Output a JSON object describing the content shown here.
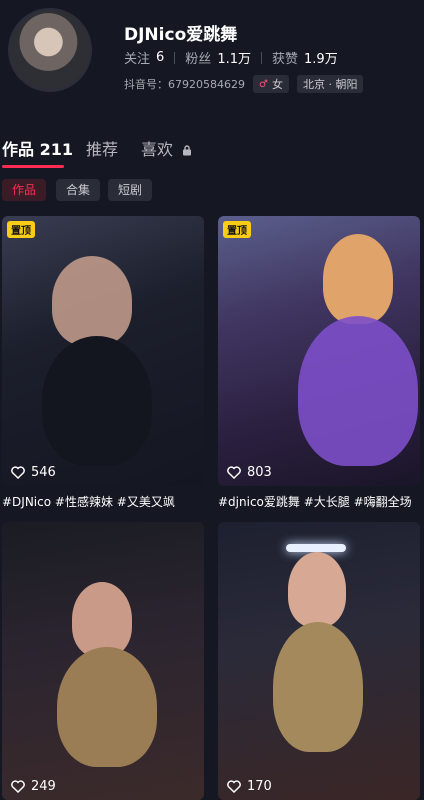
{
  "profile": {
    "nickname": "DJNico爱跳舞",
    "following_label": "关注",
    "following": "6",
    "followers_label": "粉丝",
    "followers": "1.1万",
    "likes_label": "获赞",
    "likes": "1.9万",
    "douyin_id": "抖音号：67920584629",
    "gender_symbol": "♂",
    "gender": "女",
    "location": "北京 · 朝阳"
  },
  "tabs": [
    {
      "label": "作品 211"
    },
    {
      "label": "推荐"
    },
    {
      "label": "喜欢"
    }
  ],
  "chips": [
    {
      "label": "作品"
    },
    {
      "label": "合集"
    },
    {
      "label": "短剧"
    }
  ],
  "videos": [
    {
      "badge": "置顶",
      "likes": "546",
      "caption": "#DJNico #性感辣妹 #又美又飒"
    },
    {
      "badge": "置顶",
      "likes": "803",
      "caption": "#djnico爱跳舞 #大长腿 #嗨翻全场"
    },
    {
      "likes": "249"
    },
    {
      "likes": "170"
    }
  ],
  "colors": {
    "accent": "#fe2c55",
    "badge": "#facc15",
    "background": "#151722"
  }
}
